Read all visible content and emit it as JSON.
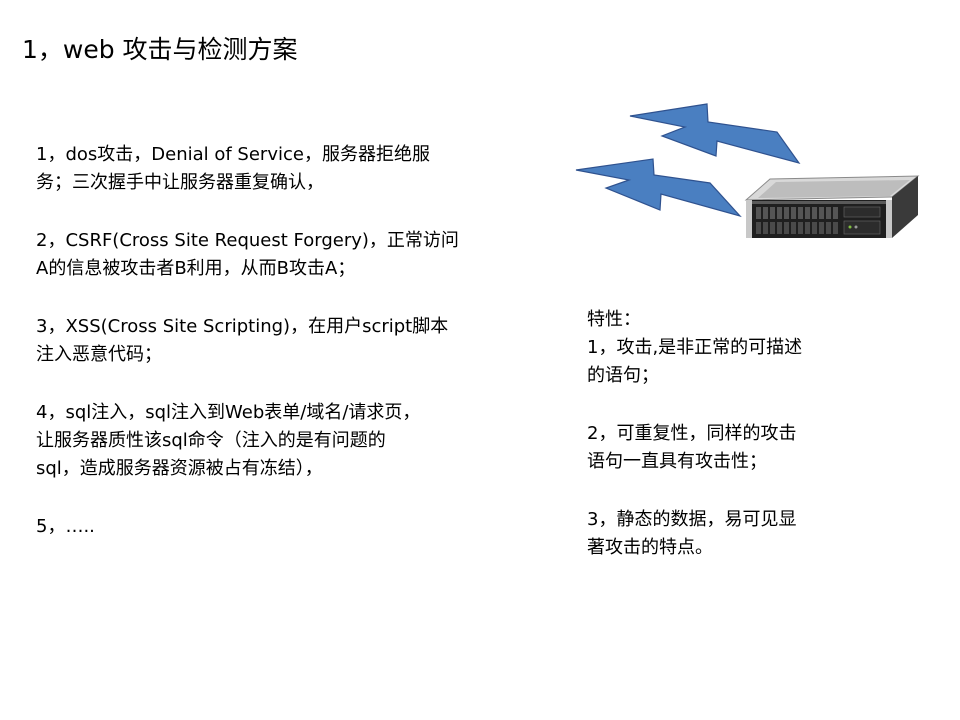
{
  "slide": {
    "title": "1，web 攻击与检测方案"
  },
  "attacks": [
    {
      "lines": [
        "1，dos攻击，Denial of Service，服务器拒绝服",
        "务；三次握手中让服务器重复确认，"
      ]
    },
    {
      "lines": [
        "2，CSRF(Cross Site Request Forgery)，正常访问",
        "A的信息被攻击者B利用，从而B攻击A；"
      ]
    },
    {
      "lines": [
        "3，XSS(Cross Site Scripting)，在用户script脚本",
        "注入恶意代码；"
      ]
    },
    {
      "lines": [
        "4，sql注入，sql注入到Web表单/域名/请求页，",
        "让服务器质性该sql命令（注入的是有问题的",
        "sql，造成服务器资源被占有冻结），"
      ]
    },
    {
      "lines": [
        "5，….."
      ]
    }
  ],
  "features": {
    "heading": "特性：",
    "items": [
      {
        "lines": [
          "1，攻击,是非正常的可描述",
          "的语句；"
        ]
      },
      {
        "lines": [
          "2，可重复性，同样的攻击",
          "语句一直具有攻击性；"
        ]
      },
      {
        "lines": [
          "3，静态的数据，易可见显",
          "著攻击的特点。"
        ]
      }
    ]
  },
  "colors": {
    "bolt_fill": "#4a7fc1",
    "bolt_stroke": "#2f528f",
    "server_dark": "#1f1f1f",
    "server_silver": "#c8c8c8"
  },
  "icons": {
    "bolts": "lightning-bolt-icon",
    "server": "rack-server-icon"
  }
}
